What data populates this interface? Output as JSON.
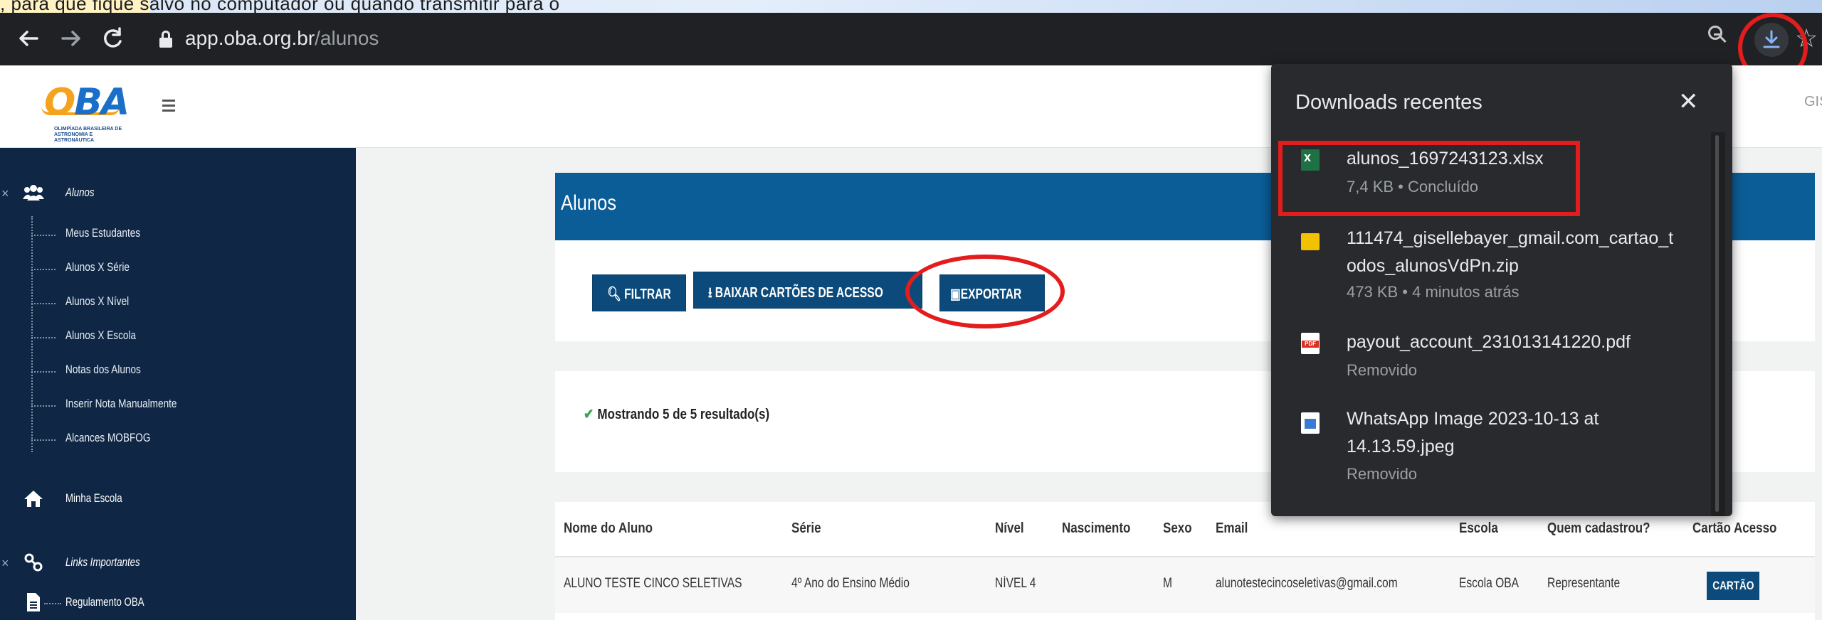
{
  "browser": {
    "url_host": "app.oba.org.br",
    "url_path": "/alunos",
    "top_strip_text": ", para que fique salvo no computador ou quando transmitir para o"
  },
  "header": {
    "logo_text": "OBA",
    "logo_subtitle": "OLIMPÍADA BRASILEIRA DE ASTRONOMIA E ASTRONÁUTICA",
    "user_text": "GIS"
  },
  "sidebar": {
    "section_alunos": "Alunos",
    "items": [
      {
        "label": "Meus Estudantes"
      },
      {
        "label": "Alunos X Série"
      },
      {
        "label": "Alunos X Nível"
      },
      {
        "label": "Alunos X Escola"
      },
      {
        "label": "Notas dos Alunos"
      },
      {
        "label": "Inserir Nota Manualmente"
      },
      {
        "label": "Alcances MOBFOG"
      }
    ],
    "minha_escola": "Minha Escola",
    "section_links": "Links Importantes",
    "regulamento": "Regulamento OBA"
  },
  "main": {
    "title": "Alunos",
    "buttons": {
      "filtrar": "FILTRAR",
      "baixar": "BAIXAR CARTÕES DE ACESSO",
      "exportar": "EXPORTAR"
    },
    "results_text": "Mostrando 5 de 5 resultado(s)",
    "table": {
      "headers": [
        "Nome do Aluno",
        "Série",
        "Nível",
        "Nascimento",
        "Sexo",
        "Email",
        "Escola",
        "Quem cadastrou?",
        "Cartão Acesso"
      ],
      "rows": [
        {
          "nome": "ALUNO TESTE CINCO SELETIVAS",
          "serie": "4º Ano do Ensino Médio",
          "nivel": "NÍVEL 4",
          "nascimento": "",
          "sexo": "M",
          "email": "alunotestecincoseletivas@gmail.com",
          "escola": "Escola OBA",
          "cadastrou": "Representante",
          "cartao_label": "CARTÃO"
        }
      ]
    }
  },
  "downloads": {
    "title": "Downloads recentes",
    "items": [
      {
        "name": "alunos_1697243123.xlsx",
        "status": "7,4 KB • Concluído",
        "icon": "xlsx-file-icon"
      },
      {
        "name": "111474_gisellebayer_gmail.com_cartao_todos_alunosVdPn.zip",
        "name_line1": "111474_gisellebayer_gmail.com_cartao_t",
        "name_line2": "odos_alunosVdPn.zip",
        "status": "473 KB • 4 minutos atrás",
        "icon": "zip-folder-icon"
      },
      {
        "name": "payout_account_231013141220.pdf",
        "status": "Removido",
        "icon": "pdf-file-icon"
      },
      {
        "name": "WhatsApp Image 2023-10-13 at 14.13.59.jpeg",
        "name_line1": "WhatsApp Image 2023-10-13 at",
        "name_line2": "14.13.59.jpeg",
        "status": "Removido",
        "icon": "image-file-icon"
      }
    ]
  },
  "colors": {
    "sidebar_bg": "#0f2744",
    "primary_blue": "#0b5d98",
    "button_blue": "#0b4a7b",
    "highlight_red": "#e31d1d",
    "success_green": "#39a552"
  }
}
